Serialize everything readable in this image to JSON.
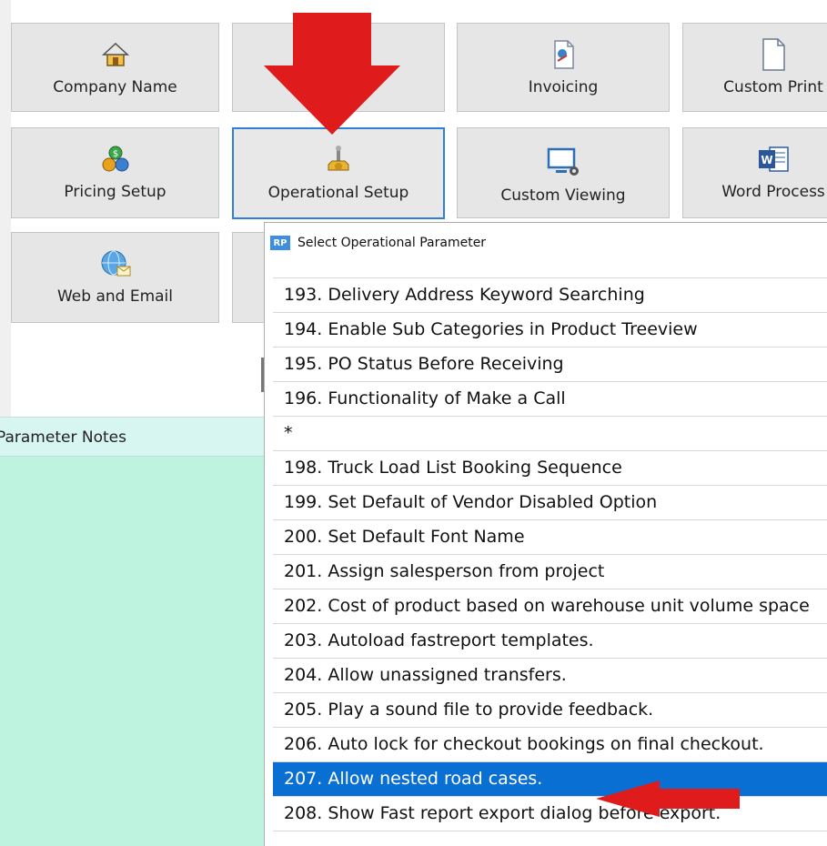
{
  "tiles": [
    {
      "name": "tile-company-name",
      "label": "Company Name",
      "icon": "house-icon"
    },
    {
      "name": "tile-second",
      "label": "",
      "icon": ""
    },
    {
      "name": "tile-invoicing",
      "label": "Invoicing",
      "icon": "document-icon"
    },
    {
      "name": "tile-custom-print",
      "label": "Custom Print",
      "icon": "blank-page-icon"
    },
    {
      "name": "tile-pricing-setup",
      "label": "Pricing Setup",
      "icon": "coins-icon"
    },
    {
      "name": "tile-operational-setup",
      "label": "Operational Setup",
      "icon": "joystick-gear-icon"
    },
    {
      "name": "tile-custom-viewing",
      "label": "Custom Viewing",
      "icon": "monitor-gear-icon"
    },
    {
      "name": "tile-word-processing",
      "label": "Word Process",
      "icon": "word-icon"
    },
    {
      "name": "tile-web-and-email",
      "label": "Web and Email",
      "icon": "globe-mail-icon"
    }
  ],
  "notes": {
    "header": "Parameter Notes"
  },
  "dialog": {
    "title": "Select Operational Parameter",
    "badge": "RP",
    "items": [
      "193. Delivery Address Keyword Searching",
      "194. Enable Sub Categories in Product Treeview",
      "195. PO Status Before Receiving",
      "196. Functionality of Make a Call",
      "*",
      "198. Truck Load List Booking Sequence",
      "199. Set Default of Vendor Disabled Option",
      "200. Set Default Font Name",
      "201. Assign salesperson from project",
      "202. Cost of product based on warehouse unit volume space",
      "203. Autoload fastreport templates.",
      "204. Allow unassigned transfers.",
      "205. Play a sound file to provide feedback.",
      "206. Auto lock for checkout bookings on final checkout.",
      "207. Allow nested road cases.",
      "208. Show Fast report export dialog before export."
    ],
    "selected_index": 14
  },
  "colors": {
    "selection": "#0a6fd3",
    "notes_bg": "#bef3df",
    "notes_header_bg": "#d7f5f1",
    "arrow": "#e01b1b",
    "tile_border_selected": "#2f7fd6"
  }
}
